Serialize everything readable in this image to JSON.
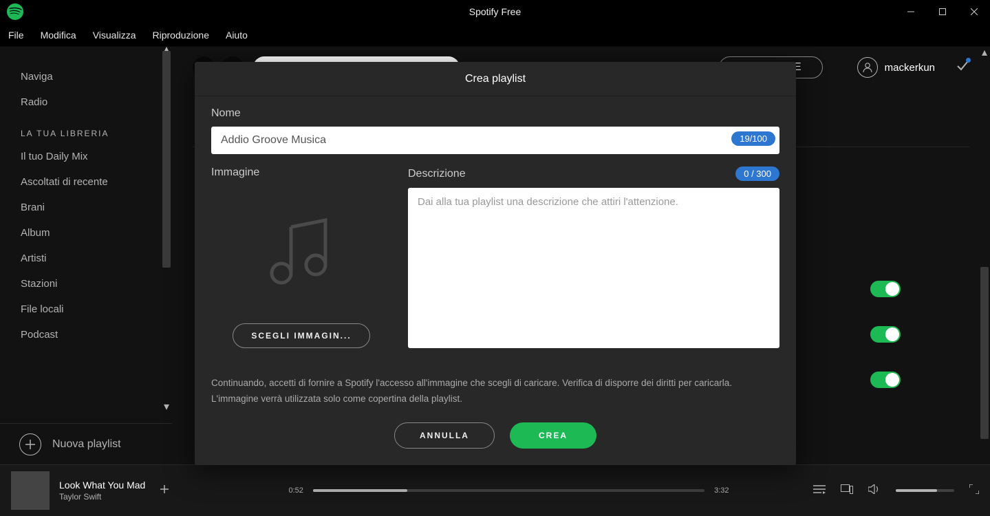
{
  "window": {
    "title": "Spotify Free"
  },
  "menu": {
    "items": [
      "File",
      "Modifica",
      "Visualizza",
      "Riproduzione",
      "Aiuto"
    ]
  },
  "sidebar": {
    "top": [
      "Naviga",
      "Radio"
    ],
    "library_header": "LA TUA LIBRERIA",
    "library": [
      "Il tuo Daily Mix",
      "Ascoltati di recente",
      "Brani",
      "Album",
      "Artisti",
      "Stazioni",
      "File locali",
      "Podcast"
    ],
    "new_playlist": "Nuova playlist"
  },
  "header": {
    "upgrade": "UPGRADE",
    "username": "mackerkun"
  },
  "modal": {
    "title": "Crea playlist",
    "name_label": "Nome",
    "name_value": "Addio Groove Musica",
    "name_counter": "19/100",
    "image_label": "Immagine",
    "choose_image": "SCEGLI IMMAGIN...",
    "desc_label": "Descrizione",
    "desc_counter": "0 / 300",
    "desc_placeholder": "Dai alla tua playlist una descrizione che attiri l'attenzione.",
    "disclaimer": "Continuando, accetti di fornire a Spotify l'accesso all'immagine che scegli di caricare. Verifica di disporre dei diritti per caricarla. L'immagine verrà utilizzata solo come copertina della playlist.",
    "cancel": "ANNULLA",
    "create": "CREA"
  },
  "player": {
    "track": "Look What You Mad",
    "artist": "Taylor Swift",
    "elapsed": "0:52",
    "total": "3:32"
  }
}
